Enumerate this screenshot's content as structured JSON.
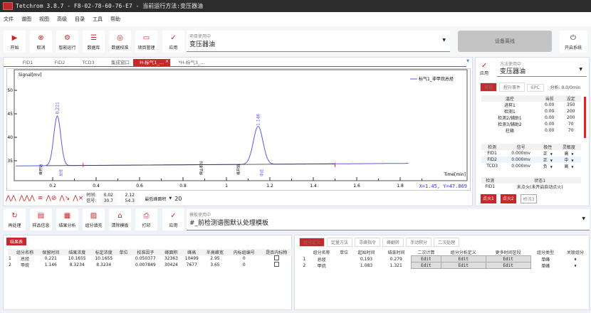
{
  "window": {
    "title": "Tetchrom 3.8.7 - F8-02-78-60-76-E7 - 当前运行方法:变压器油"
  },
  "menu": [
    "文件",
    "谱图",
    "视图",
    "高级",
    "目录",
    "工具",
    "帮助"
  ],
  "toolbar": {
    "buttons": [
      {
        "label": "开始",
        "icon": "play-icon"
      },
      {
        "label": "取消",
        "icon": "cancel-icon"
      },
      {
        "label": "智能运行",
        "icon": "smart-run-icon"
      },
      {
        "label": "数据库",
        "icon": "database-icon"
      },
      {
        "label": "数据校准",
        "icon": "calibrate-icon"
      },
      {
        "label": "项目管理",
        "icon": "folder-icon"
      }
    ],
    "apply": "应用",
    "project_caption": "项目使用中",
    "project_value": "变压器油",
    "device_status": "设备离线",
    "power_label": "开启系统"
  },
  "chart_tabs": [
    "FID1",
    "FID2",
    "TCD3",
    "集成窗口",
    "H-标气1_...",
    "*H-标气3_..."
  ],
  "active_tab": 4,
  "chart": {
    "ylabel": "Signal[mv]",
    "xlabel": "Time[min]",
    "legend": "标气1_非甲烷总烃",
    "readout": "X=1.45, Y=47.869",
    "xlim": [
      0,
      2.11
    ],
    "ylim": [
      30.8,
      54.4
    ],
    "x_ticks": [
      "0.2",
      "0.4",
      "0.6",
      "0.8",
      "1",
      "1.2",
      "1.4",
      "1.6",
      "1.8"
    ],
    "y_ticks": [
      "35",
      "40",
      "45",
      "50"
    ],
    "baseline": 33.9,
    "peaks": [
      {
        "rt": "0.221",
        "apex": 44.5,
        "width": 0.016,
        "label": "总烃"
      },
      {
        "rt": "1.146",
        "apex": 42,
        "width": 0.022,
        "label": "甲烷"
      }
    ],
    "events": [
      "峰开始",
      "停止积分",
      "峰开始"
    ],
    "series_color": "#5a5af0"
  },
  "chart_bar": {
    "time_label": "时间:",
    "signal_label": "信号:",
    "t1": "0.02",
    "t2": "2.12",
    "s1": "30.7",
    "s2": "54.3",
    "min_area_label": "最低峰面积",
    "min_area": "20"
  },
  "method": {
    "apply": "应用",
    "caption": "方法使用中",
    "value": "变压器油",
    "tabs": [
      "常规",
      "程升事件",
      "EPC"
    ],
    "analysis": "分析: 0.0/0min",
    "temp_headers": [
      "温控",
      "当前",
      "设定"
    ],
    "temp_rows": [
      [
        "进样1",
        "0.00",
        "350"
      ],
      [
        "检测1",
        "0.00",
        "200"
      ],
      [
        "检测2/辅助1",
        "0.00",
        "200"
      ],
      [
        "检测3/辅助2",
        "0.00",
        "70"
      ],
      [
        "柱箱",
        "0.00",
        "70"
      ]
    ],
    "det_headers": [
      "检测",
      "信号",
      "极性",
      "灵敏度"
    ],
    "det_rows": [
      [
        "FID1",
        "0.000mv",
        "正",
        "高"
      ],
      [
        "FID2",
        "0.000mv",
        "正",
        "中"
      ],
      [
        "TCD3",
        "0.000mv",
        "负",
        "高"
      ]
    ],
    "status_headers": [
      "检测",
      "状态1"
    ],
    "status_rows": [
      [
        "FID1",
        "未点火(未开启自动点火)"
      ]
    ],
    "ignite": [
      "点火1",
      "点火2",
      "桥流3"
    ]
  },
  "toolbar2": {
    "buttons": [
      {
        "label": "再处理",
        "icon": "reprocess-icon"
      },
      {
        "label": "样品信息",
        "icon": "sample-info-icon"
      },
      {
        "label": "结果分析",
        "icon": "result-analysis-icon"
      },
      {
        "label": "组分填充",
        "icon": "fill-icon"
      },
      {
        "label": "清除模板",
        "icon": "clear-template-icon"
      },
      {
        "label": "打印",
        "icon": "print-icon"
      }
    ],
    "apply": "应用",
    "template_caption": "模板使用中",
    "template_value": "#_前检测谱图默认处理模板"
  },
  "results": {
    "tab": "结果表",
    "headers": [
      "组分名称",
      "保留时间",
      "结果浓度",
      "标定浓度",
      "单位",
      "校准因子",
      "峰面积",
      "峰高",
      "半高峰宽",
      "内标组编号",
      "是否内标物"
    ],
    "rows": [
      [
        "1",
        "总烃",
        "0.221",
        "10.1655",
        "10.1655",
        "",
        "0.050377",
        "32363",
        "10499",
        "2.95",
        "0",
        false
      ],
      [
        "2",
        "甲烷",
        "1.146",
        "8.3234",
        "8.3234",
        "",
        "0.007849",
        "30424",
        "7677",
        "3.65",
        "0",
        false
      ]
    ]
  },
  "components": {
    "tabs": [
      "组分定义",
      "定量方法",
      "寻峰指令",
      "峰翻转",
      "手动积分",
      "二次处理"
    ],
    "headers": [
      "组分名称",
      "单位",
      "起始时间",
      "结束时间",
      "二次计算",
      "组分分析定义",
      "更多时间区段",
      "组分类型",
      "关联组分"
    ],
    "rows": [
      [
        "1",
        "总烃",
        "",
        "0.193",
        "0.279",
        "Edit",
        "Edit",
        "Edit",
        "单峰"
      ],
      [
        "2",
        "甲烷",
        "",
        "1.083",
        "1.321",
        "Edit",
        "Edit",
        "Edit",
        "单峰"
      ]
    ]
  }
}
